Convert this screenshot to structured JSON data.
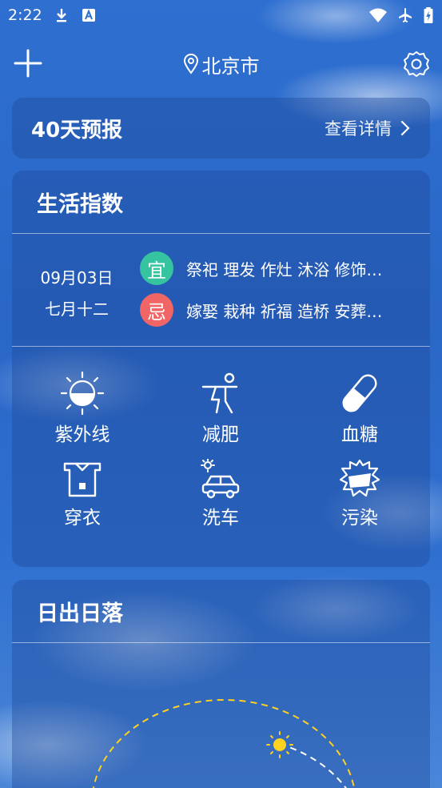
{
  "status_bar": {
    "time": "2:22"
  },
  "header": {
    "city": "北京市"
  },
  "forecast": {
    "title": "40天预报",
    "link_label": "查看详情"
  },
  "life_index": {
    "title": "生活指数",
    "date_solar": "09月03日",
    "date_lunar": "七月十二",
    "yi": {
      "badge": "宜",
      "color": "#35c3a0",
      "text": "祭祀 理发 作灶 沐浴 修饰…"
    },
    "ji": {
      "badge": "忌",
      "color": "#f06565",
      "text": "嫁娶 栽种 祈福 造桥 安葬…"
    },
    "items": [
      {
        "label": "紫外线",
        "icon": "uv-sun-icon"
      },
      {
        "label": "减肥",
        "icon": "exercise-person-icon"
      },
      {
        "label": "血糖",
        "icon": "pill-capsule-icon"
      },
      {
        "label": "穿衣",
        "icon": "shirt-icon"
      },
      {
        "label": "洗车",
        "icon": "car-wash-icon"
      },
      {
        "label": "污染",
        "icon": "pollution-icon"
      }
    ]
  },
  "sunrise": {
    "title": "日出日落",
    "sun_color": "#ffd21f"
  }
}
